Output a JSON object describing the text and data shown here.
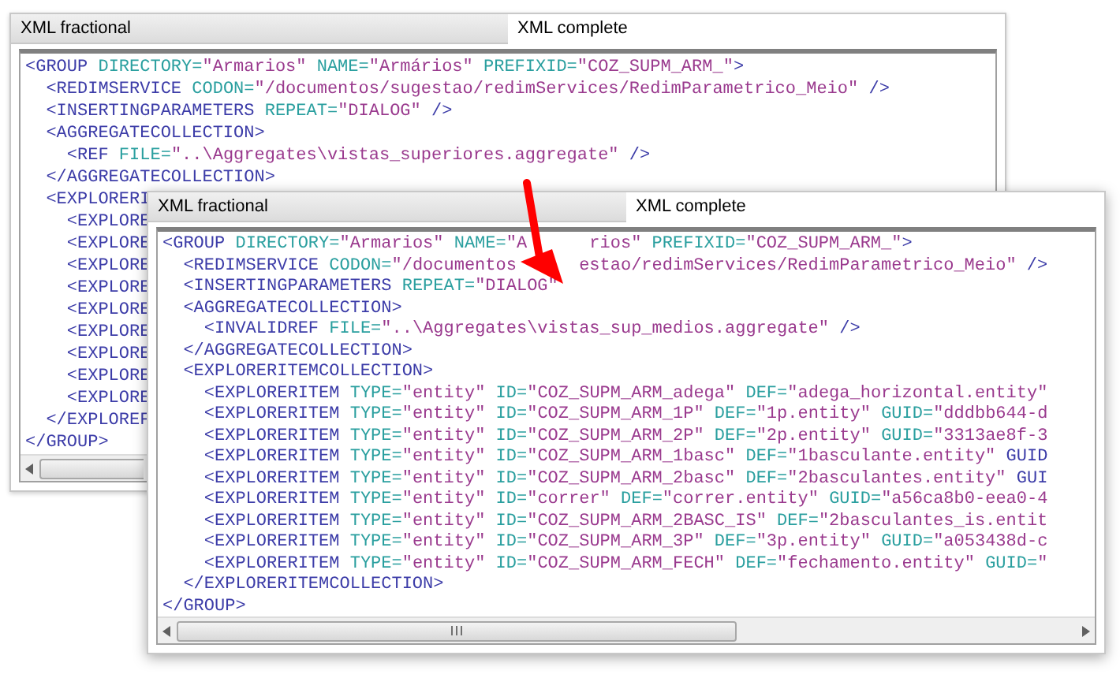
{
  "windows": [
    {
      "tabs": [
        {
          "label": "XML fractional",
          "selected": false
        },
        {
          "label": "XML complete",
          "selected": true
        }
      ],
      "lines": [
        "<GROUP DIRECTORY=\"Armarios\" NAME=\"Armários\" PREFIXID=\"COZ_SUPM_ARM_\">",
        "  <REDIMSERVICE CODON=\"/documentos/sugestao/redimServices/RedimParametrico_Meio\" />",
        "  <INSERTINGPARAMETERS REPEAT=\"DIALOG\" />",
        "  <AGGREGATECOLLECTION>",
        "    <REF FILE=\"..\\Aggregates\\vistas_superiores.aggregate\" />",
        "  </AGGREGATECOLLECTION>",
        "  <EXPLORERI",
        "    <EXPLORE",
        "    <EXPLORE",
        "    <EXPLORE",
        "    <EXPLORE",
        "    <EXPLORE",
        "    <EXPLORE",
        "    <EXPLORE",
        "    <EXPLORE",
        "    <EXPLORE",
        "  </EXPLOREF",
        "</GROUP>"
      ]
    },
    {
      "tabs": [
        {
          "label": "XML fractional",
          "selected": false
        },
        {
          "label": "XML complete",
          "selected": true
        }
      ],
      "lines": [
        [
          "<GROUP DIRECTORY=\"Armarios\" NAME=\"A",
          "rios\" PREFIXID=\"COZ_SUPM_ARM_\">"
        ],
        [
          "  <REDIMSERVICE CODON=\"/documentos",
          "estao/redimServices/RedimParametrico_Meio\" />"
        ],
        "  <INSERTINGPARAMETERS REPEAT=\"DIALOG\"",
        "  <AGGREGATECOLLECTION>",
        "    <INVALIDREF FILE=\"..\\Aggregates\\vistas_sup_medios.aggregate\" />",
        "  </AGGREGATECOLLECTION>",
        "  <EXPLORERITEMCOLLECTION>",
        "    <EXPLORERITEM TYPE=\"entity\" ID=\"COZ_SUPM_ARM_adega\" DEF=\"adega_horizontal.entity\"",
        "    <EXPLORERITEM TYPE=\"entity\" ID=\"COZ_SUPM_ARM_1P\" DEF=\"1p.entity\" GUID=\"dddbb644-d",
        "    <EXPLORERITEM TYPE=\"entity\" ID=\"COZ_SUPM_ARM_2P\" DEF=\"2p.entity\" GUID=\"3313ae8f-3",
        "    <EXPLORERITEM TYPE=\"entity\" ID=\"COZ_SUPM_ARM_1basc\" DEF=\"1basculante.entity\" GUID",
        "    <EXPLORERITEM TYPE=\"entity\" ID=\"COZ_SUPM_ARM_2basc\" DEF=\"2basculantes.entity\" GUI",
        "    <EXPLORERITEM TYPE=\"entity\" ID=\"correr\" DEF=\"correr.entity\" GUID=\"a56ca8b0-eea0-4",
        "    <EXPLORERITEM TYPE=\"entity\" ID=\"COZ_SUPM_ARM_2BASC_IS\" DEF=\"2basculantes_is.entit",
        "    <EXPLORERITEM TYPE=\"entity\" ID=\"COZ_SUPM_ARM_3P\" DEF=\"3p.entity\" GUID=\"a053438d-c",
        "    <EXPLORERITEM TYPE=\"entity\" ID=\"COZ_SUPM_ARM_FECH\" DEF=\"fechamento.entity\" GUID=\"",
        "  </EXPLORERITEMCOLLECTION>",
        "</GROUP>"
      ]
    }
  ]
}
